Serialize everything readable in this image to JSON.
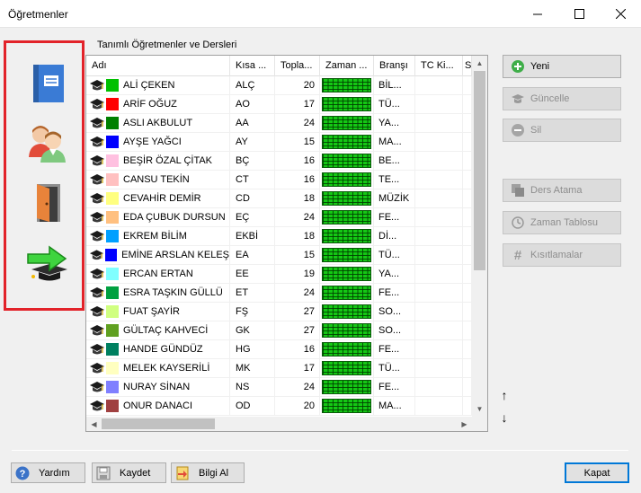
{
  "window": {
    "title": "Öğretmenler"
  },
  "group_label": "Tanımlı Öğretmenler ve Dersleri",
  "columns": [
    "Adı",
    "Kısa ...",
    "Topla...",
    "Zaman ...",
    "Branşı",
    "TC Ki...",
    "S"
  ],
  "rows": [
    {
      "name": "ALİ ÇEKEN",
      "short": "ALÇ",
      "total": "20",
      "branch": "BİL...",
      "color": "#00c000"
    },
    {
      "name": "ARİF OĞUZ",
      "short": "AO",
      "total": "17",
      "branch": "TÜ...",
      "color": "#ff0000"
    },
    {
      "name": "ASLI AKBULUT",
      "short": "AA",
      "total": "24",
      "branch": "YA...",
      "color": "#008000"
    },
    {
      "name": "AYŞE YAĞCI",
      "short": "AY",
      "total": "15",
      "branch": "MA...",
      "color": "#0000ff"
    },
    {
      "name": "BEŞİR ÖZAL ÇİTAK",
      "short": "BÇ",
      "total": "16",
      "branch": "BE...",
      "color": "#ffc0e0"
    },
    {
      "name": "CANSU TEKİN",
      "short": "CT",
      "total": "16",
      "branch": "TE...",
      "color": "#ffc0c0"
    },
    {
      "name": "CEVAHİR DEMİR",
      "short": "CD",
      "total": "18",
      "branch": "MÜZİK",
      "color": "#ffff80"
    },
    {
      "name": "EDA ÇUBUK DURSUN",
      "short": "EÇ",
      "total": "24",
      "branch": "FE...",
      "color": "#ffc080"
    },
    {
      "name": "EKREM BİLİM",
      "short": "EKBİ",
      "total": "18",
      "branch": "Dİ...",
      "color": "#00a0ff"
    },
    {
      "name": "EMİNE ARSLAN KELEŞ",
      "short": "EA",
      "total": "15",
      "branch": "TÜ...",
      "color": "#0000ff"
    },
    {
      "name": "ERCAN ERTAN",
      "short": "EE",
      "total": "19",
      "branch": "YA...",
      "color": "#80ffff"
    },
    {
      "name": "ESRA TAŞKIN GÜLLÜ",
      "short": "ET",
      "total": "24",
      "branch": "FE...",
      "color": "#00a040"
    },
    {
      "name": "FUAT ŞAYİR",
      "short": "FŞ",
      "total": "27",
      "branch": "SO...",
      "color": "#d0ff80"
    },
    {
      "name": "GÜLTAÇ KAHVECİ",
      "short": "GK",
      "total": "27",
      "branch": "SO...",
      "color": "#60a020"
    },
    {
      "name": "HANDE GÜNDÜZ",
      "short": "HG",
      "total": "16",
      "branch": "FE...",
      "color": "#008060"
    },
    {
      "name": "MELEK KAYSERİLİ",
      "short": "MK",
      "total": "17",
      "branch": "TÜ...",
      "color": "#ffffc0"
    },
    {
      "name": "NURAY SİNAN",
      "short": "NS",
      "total": "24",
      "branch": "FE...",
      "color": "#8080ff"
    },
    {
      "name": "ONUR DANACI",
      "short": "OD",
      "total": "20",
      "branch": "MA...",
      "color": "#a04040"
    }
  ],
  "side_buttons": {
    "new": "Yeni",
    "update": "Güncelle",
    "delete": "Sil",
    "assign": "Ders Atama",
    "schedule": "Zaman Tablosu",
    "constraints": "Kısıtlamalar"
  },
  "bottom_buttons": {
    "help": "Yardım",
    "save": "Kaydet",
    "info": "Bilgi Al",
    "close": "Kapat"
  },
  "side_icons": [
    "book-icon",
    "people-icon",
    "door-icon",
    "graduation-arrow-icon"
  ],
  "colors": {
    "accent_red": "#e2232a",
    "time_green": "#14c814"
  }
}
